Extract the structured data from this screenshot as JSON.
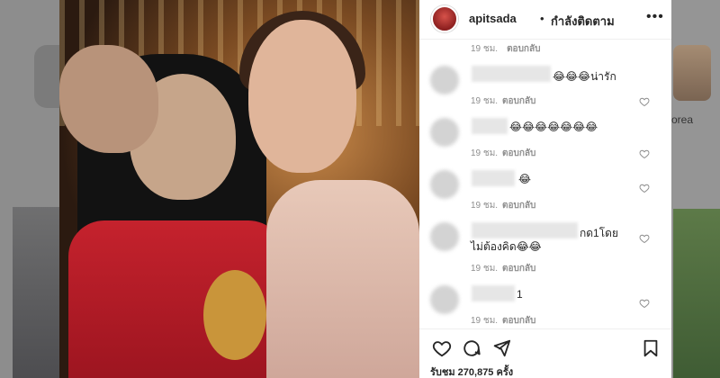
{
  "post": {
    "username": "apitsada",
    "separator": "•",
    "follow_status": "กำลังติดตาม",
    "more_icon": "more-icon"
  },
  "comments": [
    {
      "time": "19 ชม.",
      "reply": "ตอบกลับ",
      "text": "😂😂😂น่ารัก"
    },
    {
      "time": "19 ชม.",
      "reply": "ตอบกลับ",
      "text": "😂😂😂😂😂😂😂"
    },
    {
      "time": "19 ชม.",
      "reply": "ตอบกลับ",
      "text": "😂"
    },
    {
      "time": "19 ชม.",
      "reply": "ตอบกลับ",
      "text_line1": "กด1โดย",
      "text_line2": "ไม่ต้องคิด😂😂"
    },
    {
      "time": "19 ชม.",
      "reply": "ตอบกลับ",
      "text": "1"
    }
  ],
  "top_meta": {
    "time": "19 ชม.",
    "reply": "ตอบกลับ"
  },
  "likes_text": "รับชม 270,875 ครั้ง",
  "background": {
    "suggested_name": "orea"
  },
  "icons": [
    "heart-icon",
    "comment-icon",
    "share-icon",
    "bookmark-icon"
  ],
  "colors": {
    "text": "#262626",
    "muted": "#8e8e8e",
    "divider": "#efefef"
  }
}
